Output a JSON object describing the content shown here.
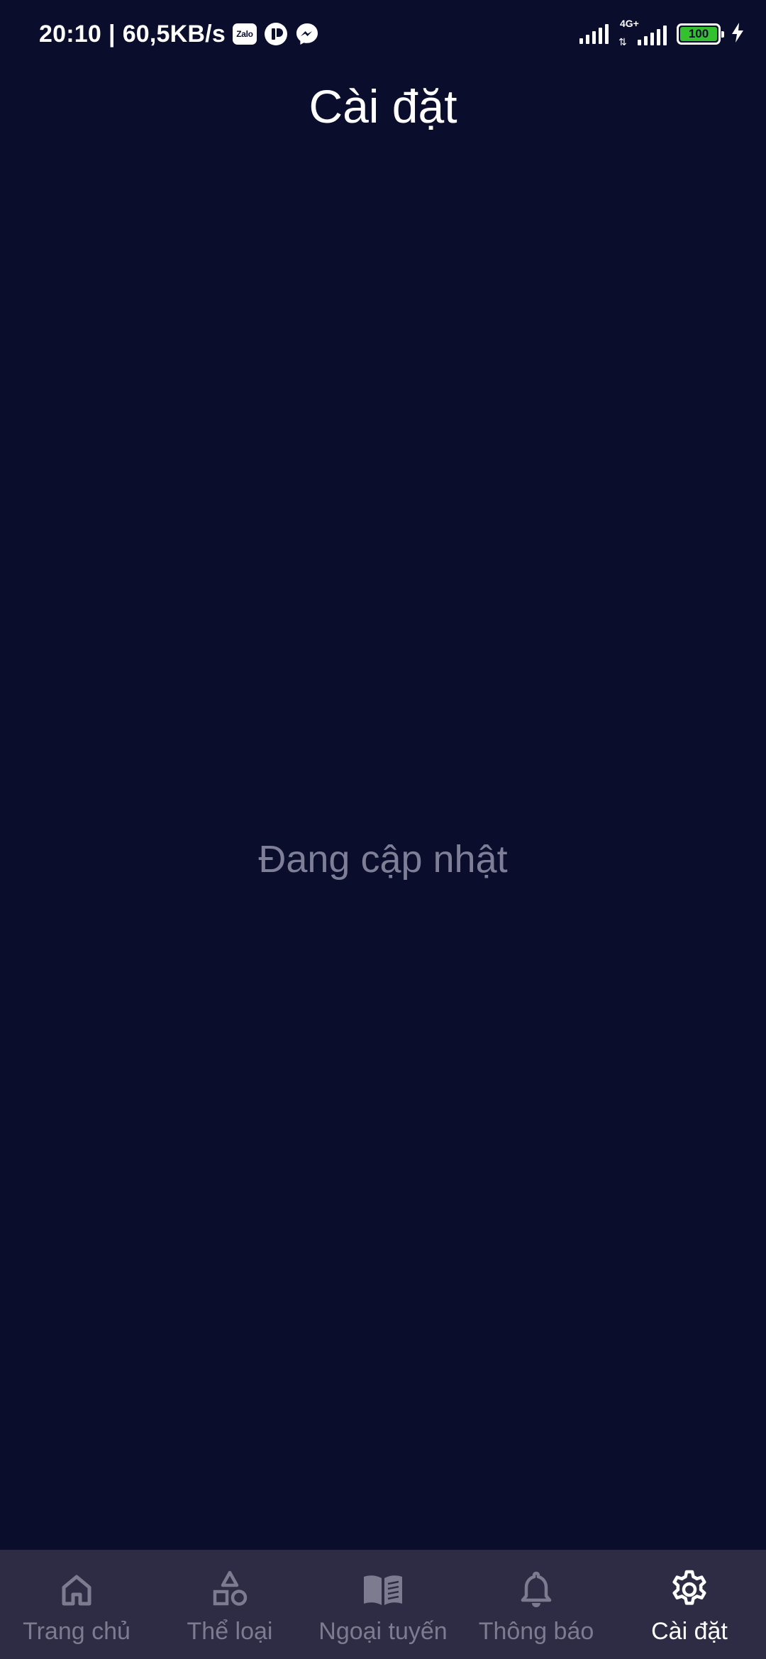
{
  "status_bar": {
    "time": "20:10",
    "separator": "|",
    "speed": "60,5KB/s",
    "notification_icons": [
      "zalo-icon",
      "app-icon",
      "messenger-icon"
    ],
    "zalo_label": "Zalo",
    "network_type": "4G+",
    "battery_level": "100",
    "charging": true
  },
  "header": {
    "title": "Cài đặt"
  },
  "main": {
    "empty_message": "Đang cập nhật"
  },
  "bottom_nav": {
    "active_index": 4,
    "items": [
      {
        "label": "Trang chủ",
        "icon": "home-icon"
      },
      {
        "label": "Thể loại",
        "icon": "shapes-icon"
      },
      {
        "label": "Ngoại tuyến",
        "icon": "book-icon"
      },
      {
        "label": "Thông báo",
        "icon": "bell-icon"
      },
      {
        "label": "Cài đặt",
        "icon": "gear-icon"
      }
    ]
  },
  "colors": {
    "background": "#0a0d2c",
    "nav_background": "#2e2b44",
    "inactive": "#7d7b90",
    "active": "#ffffff",
    "muted_text": "#7e7f96",
    "battery_fill": "#35c02f"
  }
}
